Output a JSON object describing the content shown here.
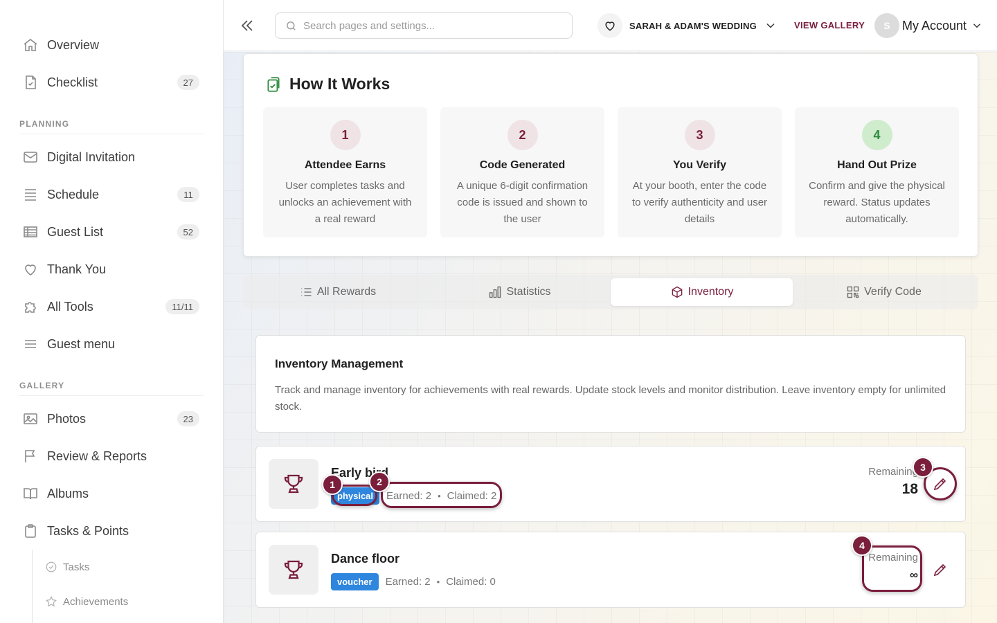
{
  "sidebar": {
    "items": [
      {
        "label": "Overview",
        "icon": "home-icon"
      },
      {
        "label": "Checklist",
        "icon": "checklist-icon",
        "count": "27"
      }
    ],
    "planning_header": "PLANNING",
    "planning": [
      {
        "label": "Digital Invitation",
        "icon": "mail-icon"
      },
      {
        "label": "Schedule",
        "icon": "schedule-icon",
        "count": "11"
      },
      {
        "label": "Guest List",
        "icon": "table-icon",
        "count": "52"
      },
      {
        "label": "Thank You",
        "icon": "heart-icon"
      },
      {
        "label": "All Tools",
        "icon": "puzzle-icon",
        "count": "11/11"
      },
      {
        "label": "Guest menu",
        "icon": "menu-icon"
      }
    ],
    "gallery_header": "GALLERY",
    "gallery": [
      {
        "label": "Photos",
        "icon": "image-icon",
        "count": "23"
      },
      {
        "label": "Review & Reports",
        "icon": "flag-icon"
      },
      {
        "label": "Albums",
        "icon": "book-icon"
      },
      {
        "label": "Tasks & Points",
        "icon": "clipboard-icon"
      }
    ],
    "sub": [
      {
        "label": "Tasks",
        "icon": "check-circle-icon"
      },
      {
        "label": "Achievements",
        "icon": "star-icon"
      }
    ]
  },
  "topbar": {
    "search_placeholder": "Search pages and settings...",
    "event_name": "SARAH & ADAM'S WEDDING",
    "view_gallery": "VIEW GALLERY",
    "avatar_initial": "S",
    "account_label": "My Account"
  },
  "how": {
    "title": "How It Works",
    "steps": [
      {
        "num": "1",
        "title": "Attendee Earns",
        "desc": "User completes tasks and unlocks an achievement with a real reward"
      },
      {
        "num": "2",
        "title": "Code Generated",
        "desc": "A unique 6-digit confirmation code is issued and shown to the user"
      },
      {
        "num": "3",
        "title": "You Verify",
        "desc": "At your booth, enter the code to verify authenticity and user details"
      },
      {
        "num": "4",
        "title": "Hand Out Prize",
        "desc": "Confirm and give the physical reward. Status updates automatically."
      }
    ]
  },
  "tabs": [
    {
      "label": "All Rewards",
      "icon": "list-icon"
    },
    {
      "label": "Statistics",
      "icon": "bar-chart-icon"
    },
    {
      "label": "Inventory",
      "icon": "box-icon",
      "active": true
    },
    {
      "label": "Verify Code",
      "icon": "qr-code-icon"
    }
  ],
  "inventory": {
    "title": "Inventory Management",
    "desc": "Track and manage inventory for achievements with real rewards. Update stock levels and monitor distribution. Leave inventory empty for unlimited stock."
  },
  "rewards": [
    {
      "name": "Early bird",
      "type": "physical",
      "earned": "Earned: 2",
      "claimed": "Claimed: 2",
      "remaining_label": "Remaining",
      "remaining": "18"
    },
    {
      "name": "Dance floor",
      "type": "voucher",
      "earned": "Earned: 2",
      "claimed": "Claimed: 0",
      "remaining_label": "Remaining",
      "remaining": "∞"
    }
  ],
  "markers": [
    "1",
    "2",
    "3",
    "4"
  ],
  "colors": {
    "accent": "#7a1e3c",
    "badge": "#2f86de",
    "success": "#2e8b3e"
  }
}
